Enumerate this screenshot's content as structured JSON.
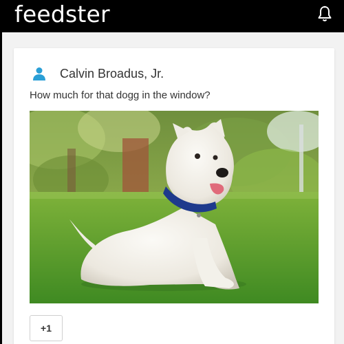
{
  "header": {
    "brand": "feedster",
    "notification_icon": "bell-icon"
  },
  "post": {
    "author": "Calvin Broadus, Jr.",
    "author_icon": "user-icon",
    "text": "How much for that dogg in the window?",
    "image_alt": "white terrier dog sitting on grass",
    "plus_label": "+1"
  },
  "colors": {
    "topbar": "#000000",
    "page_bg": "#f2f2f2",
    "accent": "#2a9fd6"
  }
}
